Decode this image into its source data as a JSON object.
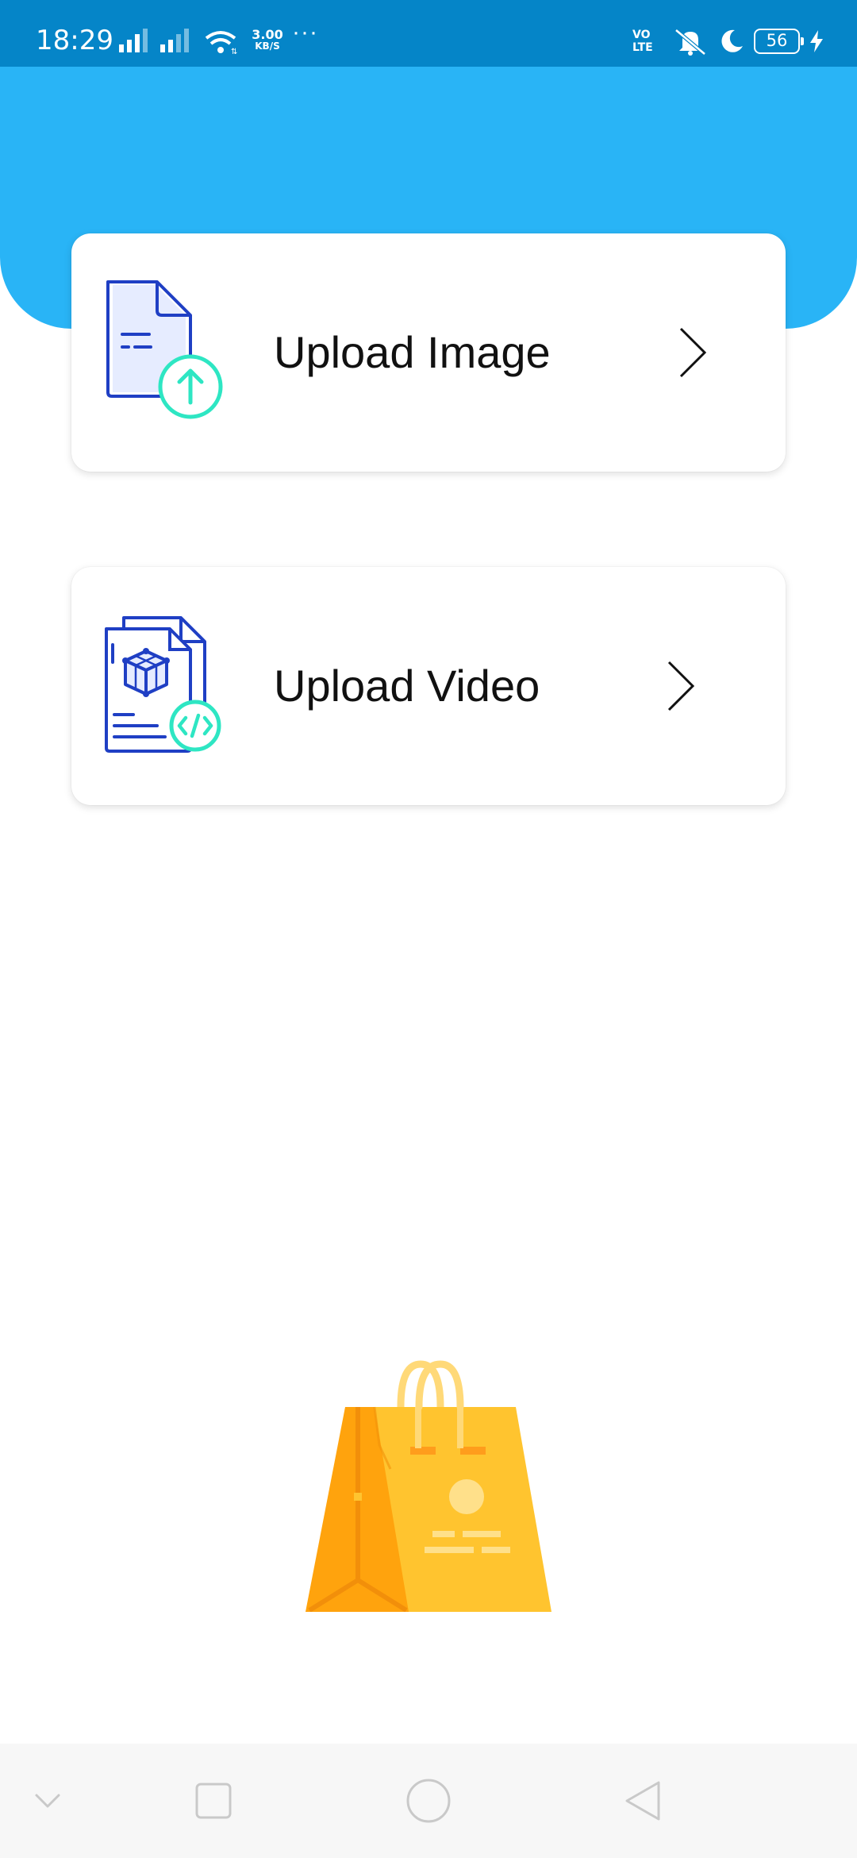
{
  "status_bar": {
    "time": "18:29",
    "network_speed": "3.00",
    "network_speed_unit": "KB/S",
    "more_indicator": "···",
    "volte_line1": "VO",
    "volte_line2": "LTE",
    "battery_level": "56",
    "icons": [
      "signal-icon",
      "signal-icon",
      "wifi-icon",
      "volte-icon",
      "bell-muted-icon",
      "moon-icon",
      "battery-icon",
      "charging-icon"
    ]
  },
  "main": {
    "cards": [
      {
        "label": "Upload Image",
        "icon": "file-upload-icon"
      },
      {
        "label": "Upload Video",
        "icon": "file-code-icon"
      }
    ],
    "illustration": "shopping-bag-icon"
  },
  "nav_bar": {
    "buttons": [
      "collapse-icon",
      "recents-icon",
      "home-icon",
      "back-icon"
    ]
  },
  "colors": {
    "status_bar": "#0585c8",
    "header": "#29b4f6",
    "icon_blue": "#1f3fc4",
    "icon_teal": "#2ee6c3",
    "bag_light": "#ffc42f",
    "bag_dark": "#ffa30d"
  }
}
